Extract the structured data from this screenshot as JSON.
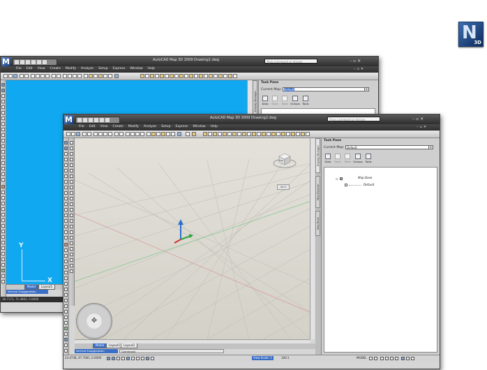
{
  "product_logo": {
    "letter": "N",
    "badge": "3D"
  },
  "back_window": {
    "title": "AutoCAD Map 3D 2009  Drawing1.dwg",
    "search_placeholder": "Type a keyword or phrase",
    "menu": [
      "File",
      "Edit",
      "View",
      "Create",
      "Modify",
      "Analyze",
      "Setup",
      "Express",
      "Window",
      "Help"
    ],
    "ucs": {
      "y_label": "Y",
      "x_label": "X"
    },
    "layout_tabs": [
      "Model",
      "Layout1"
    ],
    "active_tab": "Vertical Exaggeration",
    "status_coords": "38.7173, 71.4602, 0.0000",
    "canvas_color": "#10a8f0"
  },
  "front_window": {
    "title": "AutoCAD Map 3D 2009  Drawing2.dwg",
    "search_placeholder": "Type a keyword or phrase",
    "menu": [
      "File",
      "Edit",
      "View",
      "Create",
      "Modify",
      "Analyze",
      "Setup",
      "Express",
      "Window",
      "Help"
    ],
    "layout_tabs": [
      "Model",
      "Layout1",
      "Layout2"
    ],
    "active_tab": "Vertical Exaggeration",
    "command_label": "Command:",
    "status_coords": "23.4738, 47.7081, 0.0000",
    "view_scale": "View Scale: 1",
    "scale_value": "100:1",
    "model_label": "MODEL",
    "viewcube_label": "TOP",
    "wcs_label": "WCS"
  },
  "task_pane": {
    "title": "Task Pane",
    "current_map_label": "Current Map:",
    "current_map_value": "Default",
    "tools": [
      {
        "label": "Data",
        "enabled": true
      },
      {
        "label": "Style",
        "enabled": false
      },
      {
        "label": "Table",
        "enabled": false
      },
      {
        "label": "Groups",
        "enabled": true
      },
      {
        "label": "Tools",
        "enabled": true
      }
    ],
    "side_tabs": [
      "Display Manager",
      "Map Explorer",
      "Map Book"
    ],
    "tree": {
      "root": "Map Base",
      "child": "Default"
    }
  }
}
